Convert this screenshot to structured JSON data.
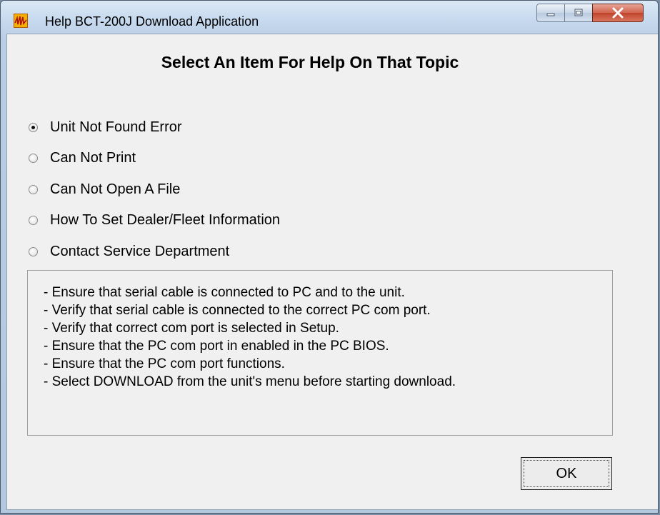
{
  "window": {
    "title": "Help BCT-200J Download Application",
    "icon": "app-logo-icon",
    "controls": {
      "minimize": "minimize-icon",
      "maximize": "maximize-icon",
      "close": "close-icon"
    }
  },
  "dialog": {
    "heading": "Select An Item For Help On That Topic",
    "options": [
      {
        "label": "Unit Not Found Error",
        "selected": true
      },
      {
        "label": "Can Not Print",
        "selected": false
      },
      {
        "label": "Can Not Open A File",
        "selected": false
      },
      {
        "label": "How To Set Dealer/Fleet Information",
        "selected": false
      },
      {
        "label": "Contact Service Department",
        "selected": false
      }
    ],
    "help_lines": [
      "- Ensure that serial cable is connected to PC and to the unit.",
      "- Verify that serial cable is connected to the correct PC com port.",
      "- Verify that correct com port is selected in Setup.",
      "- Ensure that the PC com port in enabled in the PC BIOS.",
      "- Ensure that the PC com port functions.",
      "- Select DOWNLOAD from the unit's menu before starting download."
    ],
    "ok_label": "OK"
  }
}
